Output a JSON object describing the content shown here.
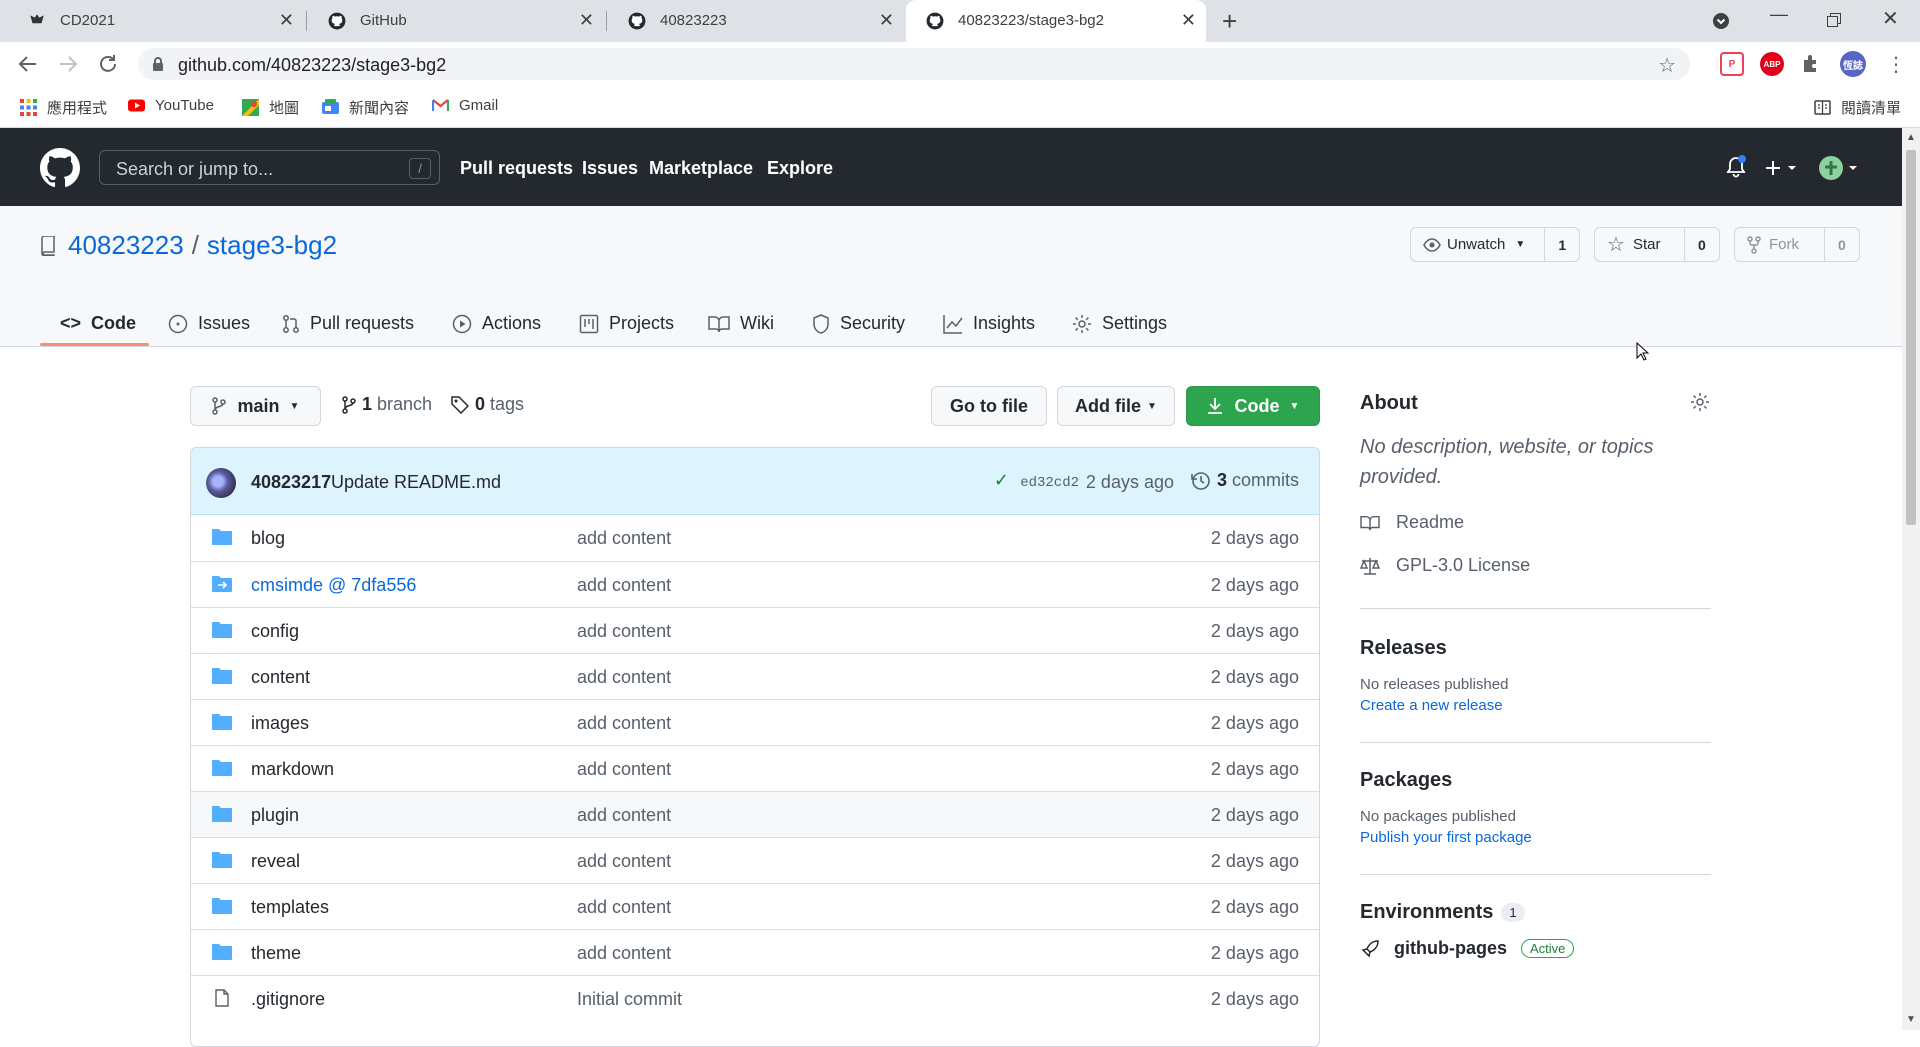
{
  "browser": {
    "tabs": [
      {
        "title": "CD2021",
        "active": false
      },
      {
        "title": "GitHub",
        "active": false
      },
      {
        "title": "40823223",
        "active": false
      },
      {
        "title": "40823223/stage3-bg2",
        "active": true
      }
    ],
    "new_tab": "+",
    "url": "github.com/40823223/stage3-bg2",
    "extensions": [
      {
        "name": "pocket-extension",
        "label": "P",
        "color": "#ef4056"
      },
      {
        "name": "adblock-extension",
        "label": "ABP",
        "color": "#e0001b"
      },
      {
        "name": "puzzle-extension",
        "label": "",
        "color": "#5f6368"
      },
      {
        "name": "profile-avatar",
        "label": "恆誌",
        "color": "#5865c4"
      }
    ],
    "bookmarks": [
      {
        "label": "應用程式",
        "icon": "apps-grid-icon"
      },
      {
        "label": "YouTube",
        "icon": "youtube-icon"
      },
      {
        "label": "地圖",
        "icon": "maps-icon"
      },
      {
        "label": "新聞內容",
        "icon": "news-icon"
      },
      {
        "label": "Gmail",
        "icon": "gmail-icon"
      }
    ],
    "reading_list": "閱讀清單"
  },
  "gh_header": {
    "search_placeholder": "Search or jump to...",
    "search_key": "/",
    "nav": [
      "Pull requests",
      "Issues",
      "Marketplace",
      "Explore"
    ]
  },
  "repo": {
    "owner": "40823223",
    "separator": "/",
    "name": "stage3-bg2",
    "watch_label": "Unwatch",
    "watch_count": "1",
    "star_label": "Star",
    "star_count": "0",
    "fork_label": "Fork",
    "fork_count": "0",
    "tabs": [
      "Code",
      "Issues",
      "Pull requests",
      "Actions",
      "Projects",
      "Wiki",
      "Security",
      "Insights",
      "Settings"
    ]
  },
  "toolbar": {
    "branch": "main",
    "branch_count": "1",
    "branch_word": "branch",
    "tag_count": "0",
    "tag_word": "tags",
    "go_to_file": "Go to file",
    "add_file": "Add file",
    "code": "Code"
  },
  "commit": {
    "author": "40823217",
    "message": "Update README.md",
    "sha": "ed32cd2",
    "time": "2 days ago",
    "count": "3",
    "count_word": "commits"
  },
  "files": [
    {
      "name": "blog",
      "type": "dir",
      "message": "add content",
      "age": "2 days ago"
    },
    {
      "name": "cmsimde @ 7dfa556",
      "type": "submodule",
      "message": "add content",
      "age": "2 days ago"
    },
    {
      "name": "config",
      "type": "dir",
      "message": "add content",
      "age": "2 days ago"
    },
    {
      "name": "content",
      "type": "dir",
      "message": "add content",
      "age": "2 days ago"
    },
    {
      "name": "images",
      "type": "dir",
      "message": "add content",
      "age": "2 days ago"
    },
    {
      "name": "markdown",
      "type": "dir",
      "message": "add content",
      "age": "2 days ago"
    },
    {
      "name": "plugin",
      "type": "dir",
      "message": "add content",
      "age": "2 days ago"
    },
    {
      "name": "reveal",
      "type": "dir",
      "message": "add content",
      "age": "2 days ago"
    },
    {
      "name": "templates",
      "type": "dir",
      "message": "add content",
      "age": "2 days ago"
    },
    {
      "name": "theme",
      "type": "dir",
      "message": "add content",
      "age": "2 days ago"
    },
    {
      "name": ".gitignore",
      "type": "file",
      "message": "Initial commit",
      "age": "2 days ago"
    }
  ],
  "about": {
    "title": "About",
    "description": "No description, website, or topics provided.",
    "readme": "Readme",
    "license": "GPL-3.0 License"
  },
  "releases": {
    "title": "Releases",
    "empty": "No releases published",
    "link": "Create a new release"
  },
  "packages": {
    "title": "Packages",
    "empty": "No packages published",
    "link": "Publish your first package"
  },
  "environments": {
    "title": "Environments",
    "count": "1",
    "name": "github-pages",
    "status": "Active"
  },
  "colors": {
    "accent_link": "#0969da",
    "header_bg": "#24292f",
    "green_button": "#2da44e",
    "folder": "#54aeff",
    "tab_underline": "#fd8c73"
  }
}
